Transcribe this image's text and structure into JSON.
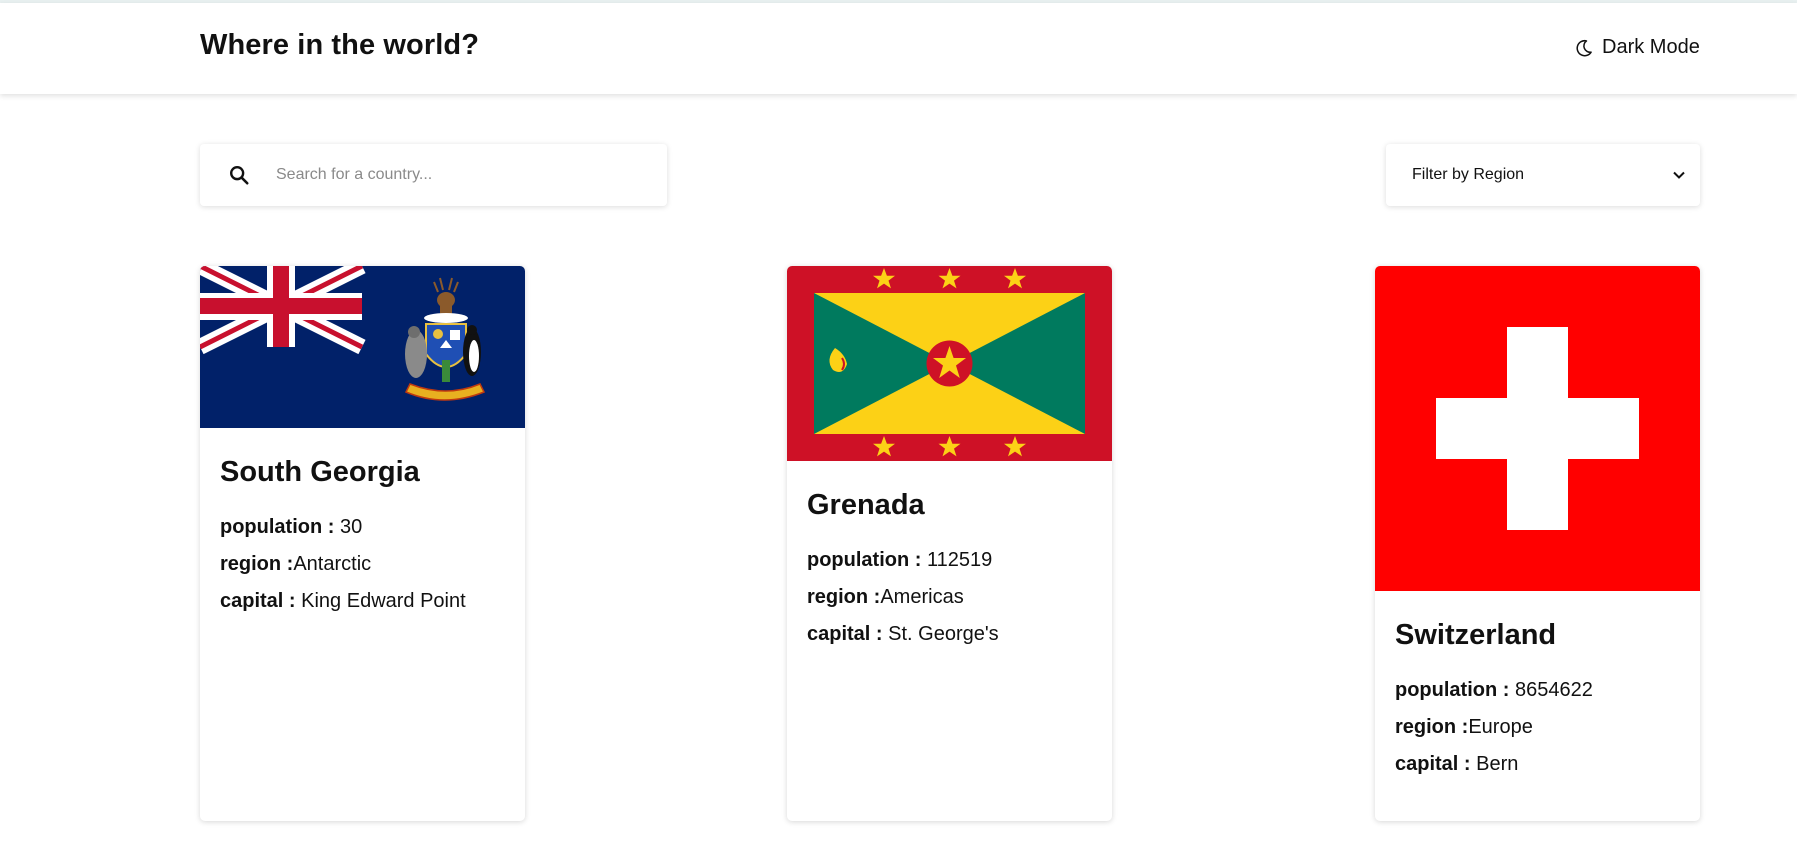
{
  "header": {
    "title": "Where in the world?",
    "dark_mode_label": "Dark Mode",
    "dark_mode_icon": "moon-icon"
  },
  "search": {
    "placeholder": "Search for a country...",
    "value": "",
    "icon": "search-icon"
  },
  "filter": {
    "label": "Filter by Region",
    "icon": "chevron-down-icon"
  },
  "labels": {
    "population": "population : ",
    "region": "region :",
    "capital": "capital : "
  },
  "countries": [
    {
      "name": "South Georgia",
      "population": "30",
      "region": "Antarctic",
      "capital": "King Edward Point",
      "flag": "south-georgia-flag"
    },
    {
      "name": "Grenada",
      "population": "112519",
      "region": "Americas",
      "capital": "St. George's",
      "flag": "grenada-flag"
    },
    {
      "name": "Switzerland",
      "population": "8654622",
      "region": "Europe",
      "capital": "Bern",
      "flag": "switzerland-flag"
    }
  ],
  "colors": {
    "background": "#ffffff",
    "text": "#111111",
    "placeholder": "#8a8a8a"
  }
}
